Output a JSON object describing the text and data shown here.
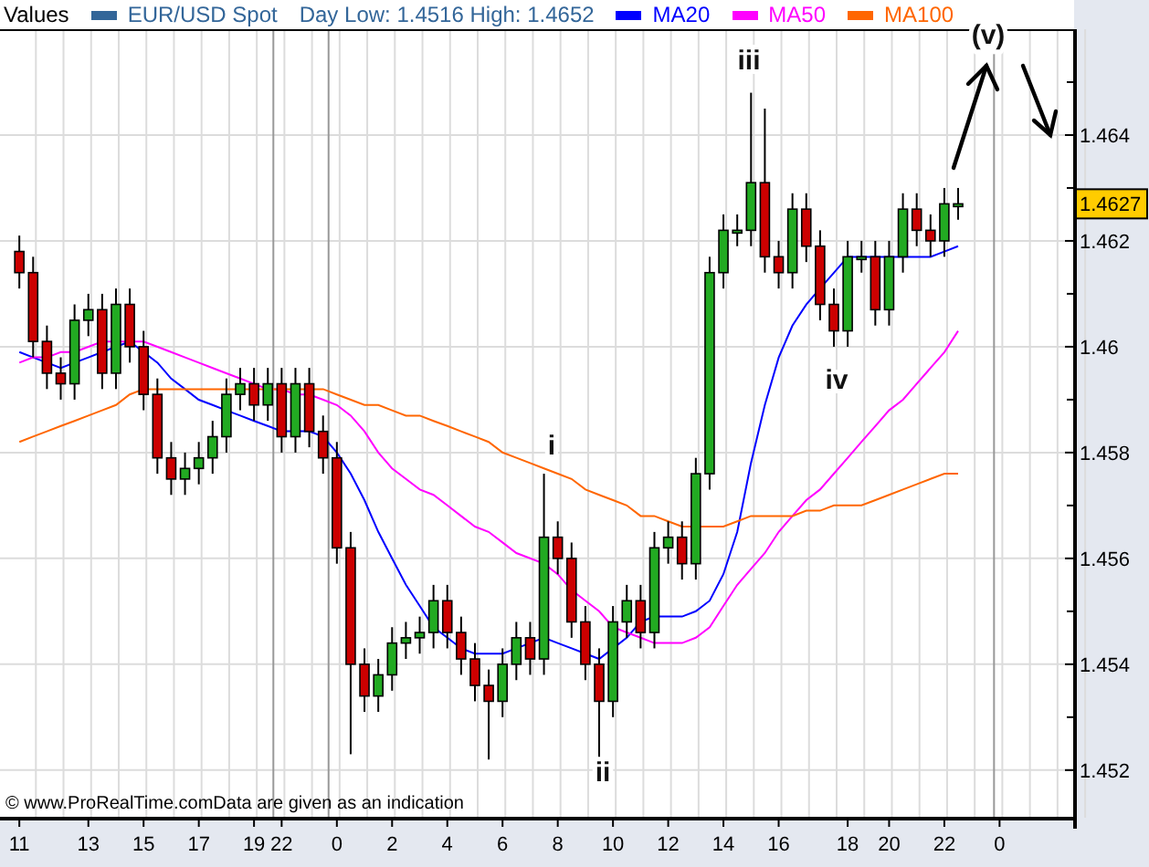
{
  "header": {
    "title": "Values",
    "instrument": {
      "label": "EUR/USD Spot",
      "color": "#336699"
    },
    "day_range": "Day Low: 1.4516 High: 1.4652"
  },
  "chart_data": {
    "type": "candlestick",
    "grid": true,
    "ylim": [
      1.4511,
      1.466
    ],
    "categories": [
      "11",
      null,
      null,
      null,
      null,
      "13",
      null,
      null,
      null,
      "15",
      null,
      null,
      null,
      "17",
      null,
      null,
      null,
      "19",
      null,
      "22",
      null,
      null,
      null,
      "0",
      null,
      null,
      null,
      "2",
      null,
      null,
      null,
      "4",
      null,
      null,
      null,
      "6",
      null,
      null,
      null,
      "8",
      null,
      null,
      null,
      "10",
      null,
      null,
      null,
      "12",
      null,
      null,
      null,
      "14",
      null,
      null,
      null,
      "16",
      null,
      null,
      null,
      null,
      "18",
      null,
      null,
      "20",
      null,
      null,
      null,
      "22",
      null,
      null,
      null,
      "0"
    ],
    "yticks": [
      1.452,
      1.454,
      1.456,
      1.458,
      1.46,
      1.462,
      1.464
    ],
    "ohlc": [
      [
        1.4618,
        1.4621,
        1.4611,
        1.4614
      ],
      [
        1.4614,
        1.4617,
        1.4598,
        1.4601
      ],
      [
        1.4601,
        1.4604,
        1.4592,
        1.4595
      ],
      [
        1.4595,
        1.4598,
        1.459,
        1.4593
      ],
      [
        1.4593,
        1.4608,
        1.459,
        1.4605
      ],
      [
        1.4605,
        1.461,
        1.4602,
        1.4607
      ],
      [
        1.4607,
        1.461,
        1.4592,
        1.4595
      ],
      [
        1.4595,
        1.4611,
        1.4592,
        1.4608
      ],
      [
        1.4608,
        1.4611,
        1.4597,
        1.46
      ],
      [
        1.46,
        1.4603,
        1.4588,
        1.4591
      ],
      [
        1.4591,
        1.4594,
        1.4576,
        1.4579
      ],
      [
        1.4579,
        1.4582,
        1.4572,
        1.4575
      ],
      [
        1.4575,
        1.458,
        1.4572,
        1.4577
      ],
      [
        1.4577,
        1.4582,
        1.4574,
        1.4579
      ],
      [
        1.4579,
        1.4586,
        1.4576,
        1.4583
      ],
      [
        1.4583,
        1.4594,
        1.458,
        1.4591
      ],
      [
        1.4591,
        1.4596,
        1.4588,
        1.4593
      ],
      [
        1.4593,
        1.4596,
        1.4586,
        1.4589
      ],
      [
        1.4589,
        1.4596,
        1.4586,
        1.4593
      ],
      [
        1.4593,
        1.4596,
        1.458,
        1.4583
      ],
      [
        1.4583,
        1.4596,
        1.458,
        1.4593
      ],
      [
        1.4593,
        1.4596,
        1.4581,
        1.4584
      ],
      [
        1.4584,
        1.4587,
        1.4576,
        1.4579
      ],
      [
        1.4579,
        1.4582,
        1.4559,
        1.4562
      ],
      [
        1.4562,
        1.4565,
        1.4523,
        1.454
      ],
      [
        1.454,
        1.4543,
        1.4531,
        1.4534
      ],
      [
        1.4534,
        1.4541,
        1.4531,
        1.4538
      ],
      [
        1.4538,
        1.4547,
        1.4535,
        1.4544
      ],
      [
        1.4544,
        1.4548,
        1.4541,
        1.4545
      ],
      [
        1.4545,
        1.4549,
        1.4542,
        1.4546
      ],
      [
        1.4546,
        1.4555,
        1.4543,
        1.4552
      ],
      [
        1.4552,
        1.4555,
        1.4543,
        1.4546
      ],
      [
        1.4546,
        1.4549,
        1.4538,
        1.4541
      ],
      [
        1.4541,
        1.4544,
        1.4533,
        1.4536
      ],
      [
        1.4536,
        1.4539,
        1.4522,
        1.4533
      ],
      [
        1.4533,
        1.4543,
        1.453,
        1.454
      ],
      [
        1.454,
        1.4548,
        1.4537,
        1.4545
      ],
      [
        1.4545,
        1.4548,
        1.4538,
        1.4541
      ],
      [
        1.4541,
        1.4576,
        1.4538,
        1.4564
      ],
      [
        1.4564,
        1.4567,
        1.4557,
        1.456
      ],
      [
        1.456,
        1.4563,
        1.4545,
        1.4548
      ],
      [
        1.4548,
        1.4551,
        1.4537,
        1.454
      ],
      [
        1.454,
        1.4543,
        1.4522,
        1.4533
      ],
      [
        1.4533,
        1.4551,
        1.453,
        1.4548
      ],
      [
        1.4548,
        1.4555,
        1.4545,
        1.4552
      ],
      [
        1.4552,
        1.4555,
        1.4543,
        1.4546
      ],
      [
        1.4546,
        1.4565,
        1.4543,
        1.4562
      ],
      [
        1.4562,
        1.4567,
        1.4559,
        1.4564
      ],
      [
        1.4564,
        1.4567,
        1.4556,
        1.4559
      ],
      [
        1.4559,
        1.4579,
        1.4556,
        1.4576
      ],
      [
        1.4576,
        1.4617,
        1.4573,
        1.4614
      ],
      [
        1.4614,
        1.4625,
        1.4611,
        1.4622
      ],
      [
        1.4622,
        1.4625,
        1.4619,
        1.4622
      ],
      [
        1.4622,
        1.4648,
        1.4619,
        1.4631
      ],
      [
        1.4631,
        1.4645,
        1.4614,
        1.4617
      ],
      [
        1.4617,
        1.462,
        1.4611,
        1.4614
      ],
      [
        1.4614,
        1.4629,
        1.4611,
        1.4626
      ],
      [
        1.4626,
        1.4629,
        1.4616,
        1.4619
      ],
      [
        1.4619,
        1.4622,
        1.4605,
        1.4608
      ],
      [
        1.4608,
        1.4611,
        1.46,
        1.4603
      ],
      [
        1.4603,
        1.462,
        1.46,
        1.4617
      ],
      [
        1.4617,
        1.462,
        1.4614,
        1.4617
      ],
      [
        1.4617,
        1.462,
        1.4604,
        1.4607
      ],
      [
        1.4607,
        1.462,
        1.4604,
        1.4617
      ],
      [
        1.4617,
        1.4629,
        1.4614,
        1.4626
      ],
      [
        1.4626,
        1.4629,
        1.4619,
        1.4622
      ],
      [
        1.4622,
        1.4625,
        1.4617,
        1.462
      ],
      [
        1.462,
        1.463,
        1.4617,
        1.4627
      ],
      [
        1.4627,
        1.463,
        1.4624,
        1.4627
      ],
      null,
      null,
      null
    ],
    "series": [
      {
        "name": "MA20",
        "type": "line",
        "color": "#0000ff",
        "values": [
          1.4599,
          1.4598,
          1.4597,
          1.4596,
          1.4597,
          1.4598,
          1.4599,
          1.46,
          1.4601,
          1.4599,
          1.4597,
          1.4594,
          1.4592,
          1.459,
          1.4589,
          1.4588,
          1.4587,
          1.4586,
          1.4585,
          1.4584,
          1.4584,
          1.4584,
          1.4583,
          1.458,
          1.4576,
          1.4571,
          1.4565,
          1.456,
          1.4555,
          1.4551,
          1.4547,
          1.4545,
          1.4543,
          1.4542,
          1.4542,
          1.4542,
          1.4543,
          1.4544,
          1.4545,
          1.4544,
          1.4543,
          1.4542,
          1.4541,
          1.4543,
          1.4545,
          1.4548,
          1.4549,
          1.4549,
          1.4549,
          1.455,
          1.4552,
          1.4557,
          1.4565,
          1.4578,
          1.4589,
          1.4598,
          1.4604,
          1.4608,
          1.4611,
          1.4614,
          1.4617,
          1.4617,
          1.4617,
          1.4617,
          1.4617,
          1.4617,
          1.4617,
          1.4618,
          1.4619,
          null,
          null,
          null
        ]
      },
      {
        "name": "MA50",
        "type": "line",
        "color": "#ff00ff",
        "values": [
          1.4597,
          1.4598,
          1.4598,
          1.4599,
          1.4599,
          1.46,
          1.4601,
          1.4601,
          1.4601,
          1.4601,
          1.46,
          1.4599,
          1.4598,
          1.4597,
          1.4596,
          1.4595,
          1.4594,
          1.4593,
          1.4592,
          1.4592,
          1.4591,
          1.4591,
          1.459,
          1.4589,
          1.4587,
          1.4584,
          1.458,
          1.4577,
          1.4575,
          1.4573,
          1.4572,
          1.457,
          1.4568,
          1.4566,
          1.4565,
          1.4563,
          1.4561,
          1.456,
          1.4559,
          1.4557,
          1.4554,
          1.4552,
          1.455,
          1.4547,
          1.4546,
          1.4545,
          1.4544,
          1.4544,
          1.4544,
          1.4545,
          1.4547,
          1.4551,
          1.4555,
          1.4558,
          1.4561,
          1.4565,
          1.4568,
          1.4571,
          1.4573,
          1.4576,
          1.4579,
          1.4582,
          1.4585,
          1.4588,
          1.459,
          1.4593,
          1.4596,
          1.4599,
          1.4603,
          null,
          null,
          null
        ]
      },
      {
        "name": "MA100",
        "type": "line",
        "color": "#ff6600",
        "values": [
          1.4582,
          1.4583,
          1.4584,
          1.4585,
          1.4586,
          1.4587,
          1.4588,
          1.4589,
          1.4591,
          1.4592,
          1.4592,
          1.4592,
          1.4592,
          1.4592,
          1.4592,
          1.4592,
          1.4592,
          1.4592,
          1.4592,
          1.4592,
          1.4592,
          1.4592,
          1.4592,
          1.4591,
          1.459,
          1.4589,
          1.4589,
          1.4588,
          1.4587,
          1.4587,
          1.4586,
          1.4585,
          1.4584,
          1.4583,
          1.4582,
          1.458,
          1.4579,
          1.4578,
          1.4577,
          1.4576,
          1.4575,
          1.4573,
          1.4572,
          1.4571,
          1.457,
          1.4568,
          1.4568,
          1.4567,
          1.4566,
          1.4566,
          1.4566,
          1.4566,
          1.4567,
          1.4568,
          1.4568,
          1.4568,
          1.4568,
          1.4569,
          1.4569,
          1.457,
          1.457,
          1.457,
          1.4571,
          1.4572,
          1.4573,
          1.4574,
          1.4575,
          1.4576,
          1.4576,
          null,
          null,
          null
        ]
      }
    ],
    "annotations": [
      "(v)",
      "iii",
      "i",
      "ii",
      "iv"
    ]
  },
  "price_marker": {
    "label": "1.4627"
  },
  "footer": "© www.ProRealTime.comData are given as an indication"
}
